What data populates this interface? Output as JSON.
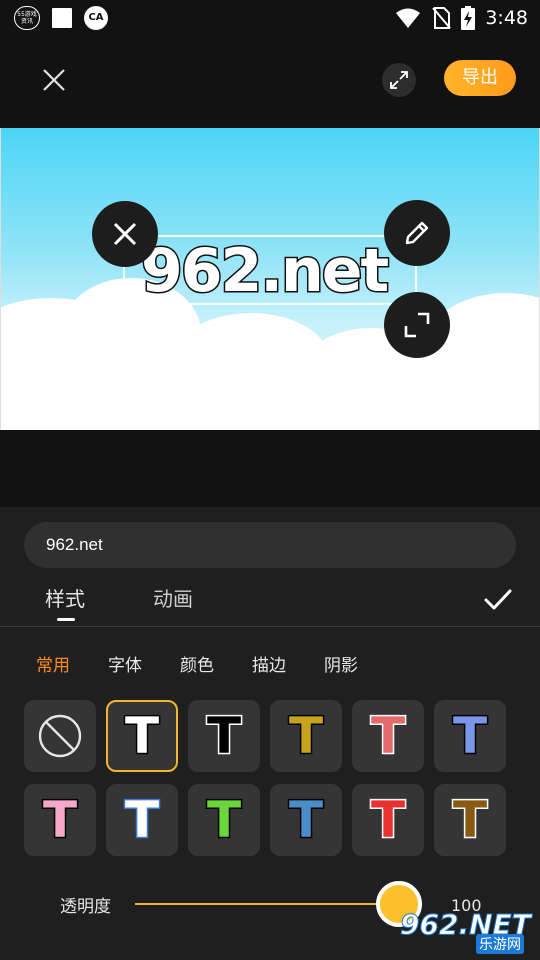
{
  "status_bar": {
    "app_badge_text": "55游戏\n资讯",
    "time": "3:48",
    "icons": [
      "wifi-icon",
      "no-sim-icon",
      "battery-charging-icon"
    ]
  },
  "toolbar": {
    "close_icon": "close-icon",
    "expand_icon": "expand-icon",
    "export_label": "导出",
    "export_color": "#ffa621"
  },
  "canvas": {
    "text": "962.net",
    "handles": [
      "delete-icon",
      "edit-icon",
      "resize-icon"
    ],
    "sky_color": "#4dd5f5"
  },
  "panel": {
    "input_value": "962.net",
    "tabs": [
      {
        "label": "样式",
        "active": true
      },
      {
        "label": "动画",
        "active": false
      }
    ],
    "confirm_icon": "checkmark-icon",
    "subtabs": [
      {
        "label": "常用",
        "active": true
      },
      {
        "label": "字体",
        "active": false
      },
      {
        "label": "颜色",
        "active": false
      },
      {
        "label": "描边",
        "active": false
      },
      {
        "label": "阴影",
        "active": false
      }
    ],
    "accent_color": "#ff8a1f",
    "styles": [
      {
        "type": "none"
      },
      {
        "fill": "#ffffff",
        "stroke": "#000000",
        "selected": true
      },
      {
        "fill": "#000000",
        "stroke": "#ffffff"
      },
      {
        "fill": "#c8a320",
        "stroke": "#000000"
      },
      {
        "fill": "#e26a6a",
        "stroke": "#ffffff"
      },
      {
        "fill": "#7b96e8",
        "stroke": "#000000"
      },
      {
        "fill": "#f5a8c8",
        "stroke": "#000000"
      },
      {
        "fill": "#ffffff",
        "stroke": "#3b79d6"
      },
      {
        "fill": "#6bd63b",
        "stroke": "#000000"
      },
      {
        "fill": "#4a8ec9",
        "stroke": "#000000"
      },
      {
        "fill": "#e83030",
        "stroke": "#ffffff"
      },
      {
        "fill": "#8b5a12",
        "stroke": "#ffffff"
      }
    ],
    "opacity": {
      "label": "透明度",
      "value": "100",
      "level": 1.0
    }
  },
  "watermark": {
    "main": "962.NET",
    "sub": "乐游网"
  }
}
